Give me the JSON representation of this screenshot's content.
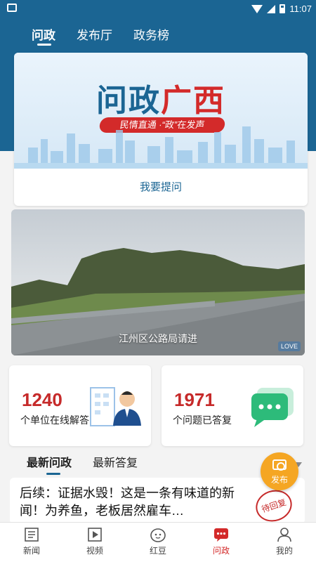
{
  "status_bar": {
    "time": "11:07"
  },
  "top_tabs": [
    {
      "label": "问政",
      "active": true
    },
    {
      "label": "发布厅"
    },
    {
      "label": "政务榜"
    }
  ],
  "banner": {
    "title_part1": "问政",
    "title_part2": "广西",
    "slogan": "民情直通 ·“政”在发声",
    "ask_link": "我要提问"
  },
  "photo": {
    "caption": "江州区公路局请进",
    "logo": "LOVE"
  },
  "stats": [
    {
      "number": "1240",
      "label": "个单位在线解答",
      "icon": "building-officer-icon"
    },
    {
      "number": "1971",
      "label": "个问题已答复",
      "icon": "chat-bubble-icon"
    }
  ],
  "list_tabs": [
    {
      "label": "最新问政",
      "active": true
    },
    {
      "label": "最新答复"
    }
  ],
  "publish_button": {
    "label": "发布",
    "icon": "camera-icon"
  },
  "news_items": [
    {
      "title": "后续：证据水毁！这是一条有味道的新闻！为养鱼，老板居然雇车…",
      "stamp": "待回复"
    }
  ],
  "bottom_nav": [
    {
      "label": "新闻",
      "icon": "newspaper-icon"
    },
    {
      "label": "视频",
      "icon": "video-icon"
    },
    {
      "label": "红豆",
      "icon": "face-icon"
    },
    {
      "label": "问政",
      "icon": "chat-dots-icon",
      "active": true
    },
    {
      "label": "我的",
      "icon": "person-icon"
    }
  ],
  "colors": {
    "primary": "#1b6593",
    "accent_red": "#d32a2a",
    "publish_orange": "#f5a623"
  }
}
